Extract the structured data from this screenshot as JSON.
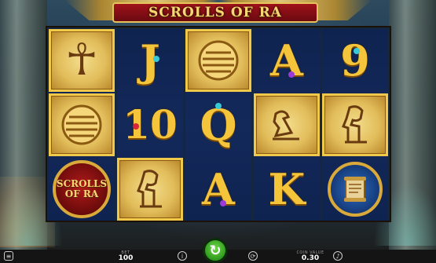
{
  "game": {
    "title": "SCROLLS OF RA"
  },
  "reels": [
    [
      {
        "symbol": "ankh",
        "glyph": "☥",
        "style": "papyrus"
      },
      {
        "symbol": "sun-disc",
        "glyph": "◉",
        "style": "papyrus"
      },
      {
        "symbol": "scrolls-of-ra-logo",
        "line1": "SCROLLS",
        "line2": "OF RA",
        "style": "logo"
      }
    ],
    [
      {
        "symbol": "J",
        "text": "J",
        "style": "gold"
      },
      {
        "symbol": "10",
        "text": "10",
        "style": "gold"
      },
      {
        "symbol": "pharaoh",
        "glyph": "𓀀",
        "style": "papyrus"
      }
    ],
    [
      {
        "symbol": "sun-disc",
        "glyph": "◉",
        "style": "papyrus"
      },
      {
        "symbol": "Q",
        "text": "Q",
        "style": "gold"
      },
      {
        "symbol": "A",
        "text": "A",
        "style": "gold"
      }
    ],
    [
      {
        "symbol": "A",
        "text": "A",
        "style": "gold"
      },
      {
        "symbol": "falcon",
        "glyph": "𓅃",
        "style": "papyrus"
      },
      {
        "symbol": "K",
        "text": "K",
        "style": "gold"
      }
    ],
    [
      {
        "symbol": "9",
        "text": "9",
        "style": "gold"
      },
      {
        "symbol": "pharaoh",
        "glyph": "𓀀",
        "style": "papyrus"
      },
      {
        "symbol": "scroll",
        "glyph": "📜",
        "style": "scroll"
      }
    ]
  ],
  "bottom_bar": {
    "bet_label": "BET",
    "bet_value": "100",
    "coin_value_label": "COIN VALUE",
    "coin_value": "0.30"
  },
  "icons": {
    "menu": "menu-icon",
    "info": "info-icon",
    "spin": "spin-icon",
    "autoplay": "autoplay-icon",
    "sound": "sound-icon"
  },
  "colors": {
    "gold": "#f4c43b",
    "title_red": "#a0121a",
    "reel_blue": "#13295a",
    "spin_green": "#3fb82a"
  }
}
